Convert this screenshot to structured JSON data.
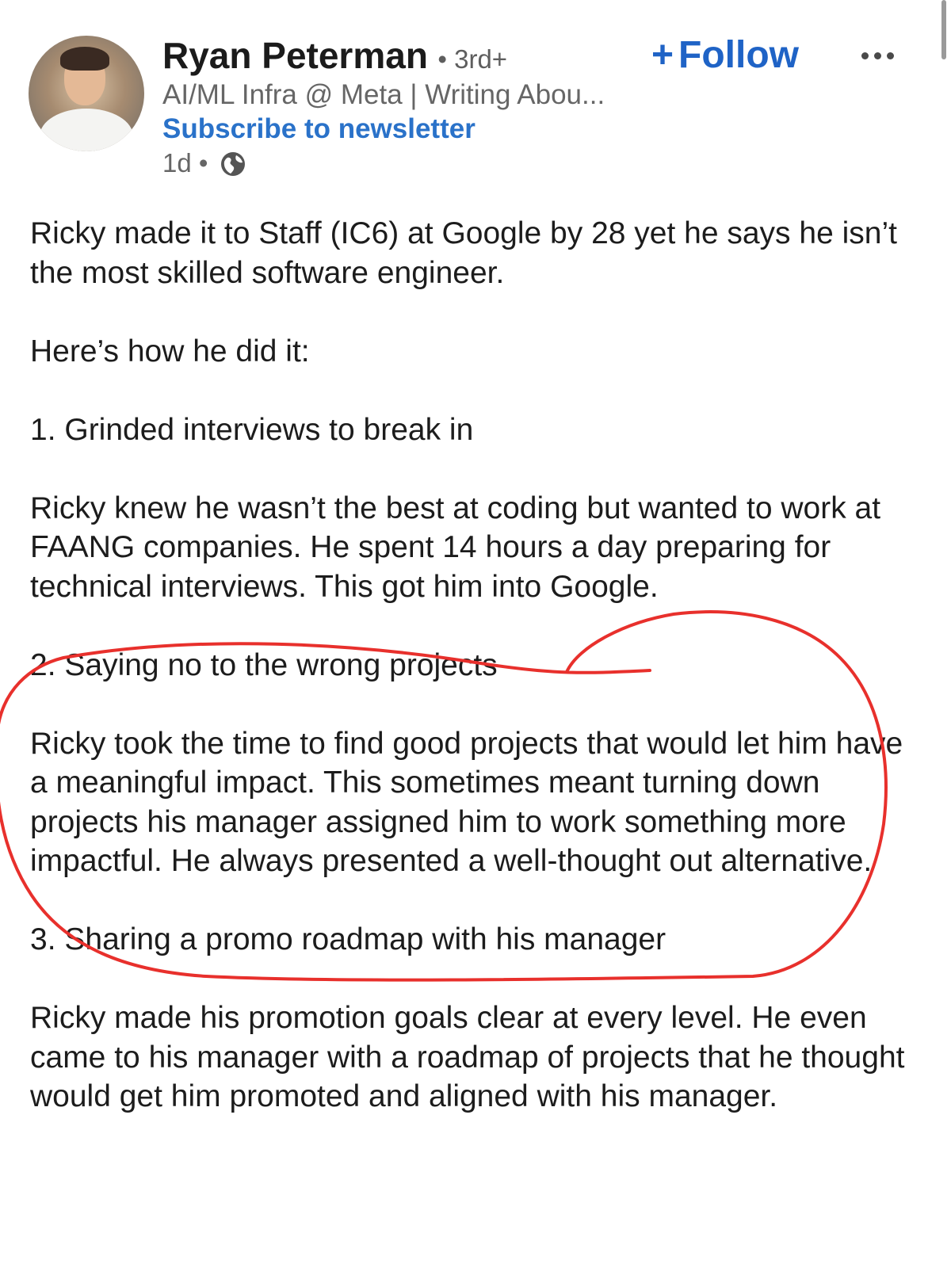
{
  "author": {
    "name": "Ryan Peterman",
    "degree": "• 3rd+",
    "headline": "AI/ML Infra @ Meta | Writing Abou...",
    "subscribe_label": "Subscribe to newsletter",
    "time": "1d •"
  },
  "actions": {
    "follow_plus": "+",
    "follow_label": "Follow"
  },
  "icons": {
    "more": "more-horizontal-icon",
    "globe": "globe-icon"
  },
  "post": {
    "paragraphs": [
      "Ricky made it to Staff (IC6) at Google by 28 yet he says he isn’t the most skilled software engineer.",
      "Here’s how he did it:",
      "1. Grinded interviews to break in",
      "Ricky knew he wasn’t the best at coding but wanted to work at FAANG companies. He spent 14 hours a day preparing for technical interviews. This got him into Google.",
      "2. Saying no to the wrong projects",
      "Ricky took the time to find good projects that would let him have a meaningful impact. This sometimes meant turning down projects his manager assigned him to work something more impactful. He always presented a well-thought out alternative.",
      "3. Sharing a promo roadmap with his manager",
      "Ricky made his promotion goals clear at every level. He even came to his manager with a roadmap of projects that he thought would get him promoted and aligned with his manager."
    ]
  },
  "colors": {
    "accent_blue": "#1f63c6",
    "annotation_red": "#e8302c",
    "text": "#1c1c1c",
    "muted": "#666666"
  }
}
